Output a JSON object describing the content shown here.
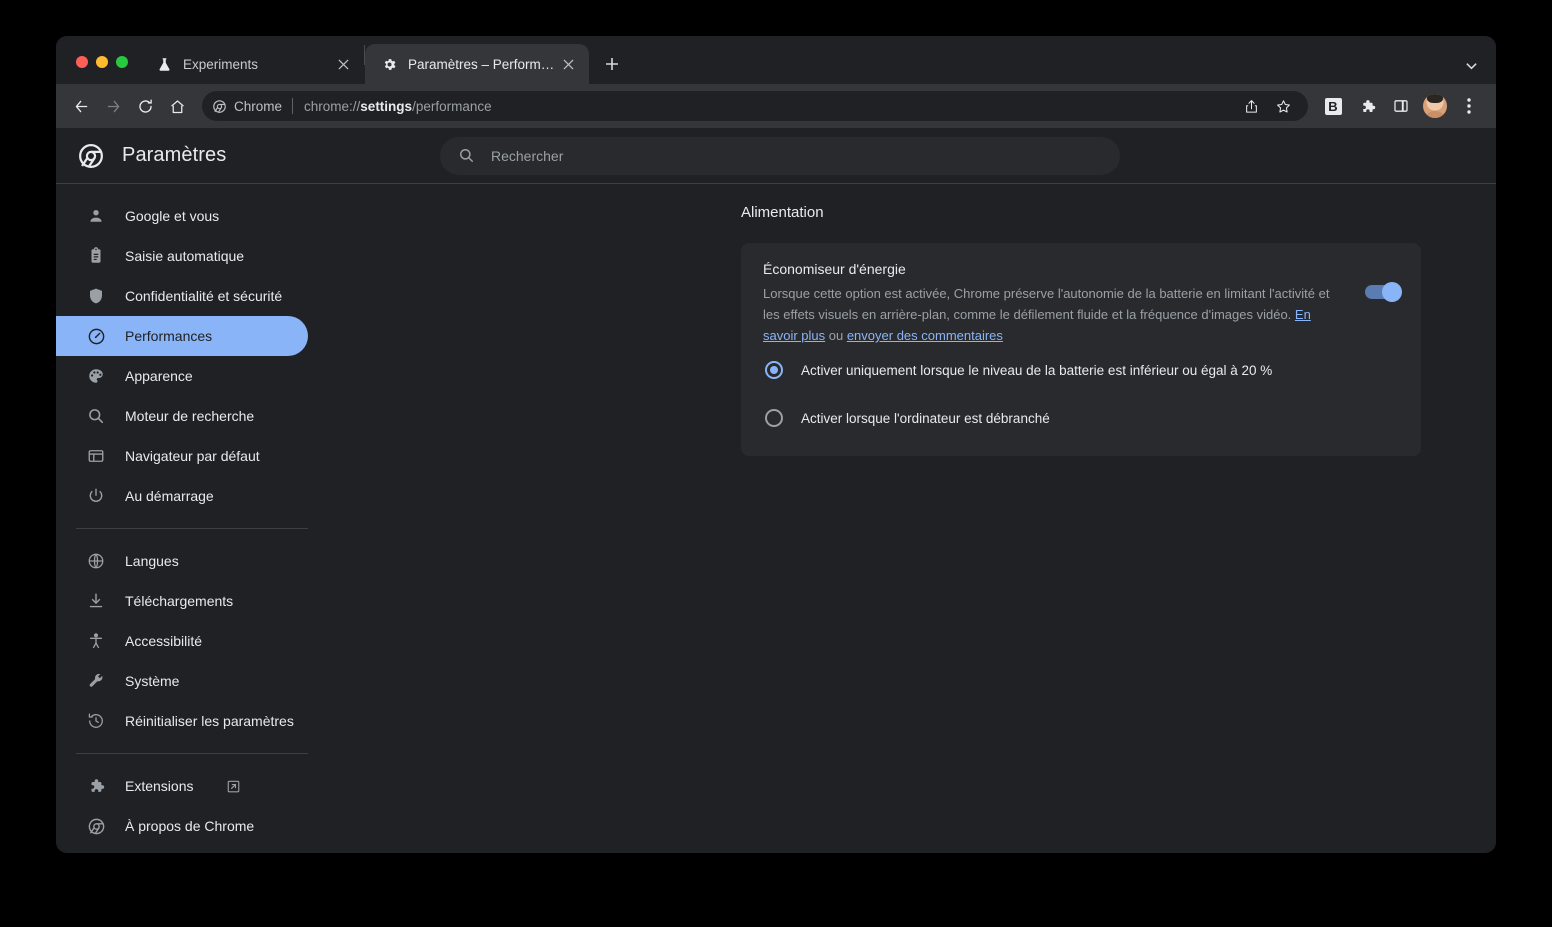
{
  "window": {
    "traffic_lights": [
      "close",
      "minimize",
      "zoom"
    ],
    "tabstrip_chevron": "chevron-down-icon"
  },
  "tabs": [
    {
      "title": "Experiments",
      "favicon": "flask-icon",
      "active": false,
      "close_label": "×"
    },
    {
      "title": "Paramètres – Performances",
      "favicon": "gear-icon",
      "active": true,
      "close_label": "×"
    }
  ],
  "new_tab_label": "+",
  "toolbar": {
    "back_icon": "arrow-left-icon",
    "forward_icon": "arrow-right-icon",
    "reload_icon": "reload-icon",
    "home_icon": "home-icon",
    "omnibox": {
      "chip_label": "Chrome",
      "url_prefix": "chrome://",
      "url_bold": "settings",
      "url_suffix": "/performance",
      "share_icon": "share-icon",
      "bookmark_icon": "star-icon"
    },
    "extension_b_label": "B",
    "extensions_icon": "puzzle-piece-icon",
    "side_panel_icon": "side-panel-icon",
    "profile_icon": "avatar",
    "menu_icon": "three-dot-menu-icon"
  },
  "settings": {
    "brand_title": "Paramètres",
    "brand_icon": "chrome-logo-icon",
    "search": {
      "placeholder": "Rechercher",
      "value": "",
      "icon": "search-icon"
    }
  },
  "sidebar": {
    "groups": [
      {
        "items": [
          {
            "label": "Google et vous",
            "icon": "person-icon",
            "selected": false
          },
          {
            "label": "Saisie automatique",
            "icon": "clipboard-icon",
            "selected": false
          },
          {
            "label": "Confidentialité et sécurité",
            "icon": "shield-icon",
            "selected": false
          },
          {
            "label": "Performances",
            "icon": "speedometer-icon",
            "selected": true
          },
          {
            "label": "Apparence",
            "icon": "palette-icon",
            "selected": false
          },
          {
            "label": "Moteur de recherche",
            "icon": "search-icon",
            "selected": false
          },
          {
            "label": "Navigateur par défaut",
            "icon": "browser-window-icon",
            "selected": false
          },
          {
            "label": "Au démarrage",
            "icon": "power-icon",
            "selected": false
          }
        ]
      },
      {
        "items": [
          {
            "label": "Langues",
            "icon": "globe-icon",
            "selected": false
          },
          {
            "label": "Téléchargements",
            "icon": "download-icon",
            "selected": false
          },
          {
            "label": "Accessibilité",
            "icon": "accessibility-icon",
            "selected": false
          },
          {
            "label": "Système",
            "icon": "wrench-icon",
            "selected": false
          },
          {
            "label": "Réinitialiser les paramètres",
            "icon": "history-restore-icon",
            "selected": false
          }
        ]
      },
      {
        "items": [
          {
            "label": "Extensions",
            "icon": "puzzle-piece-icon",
            "selected": false,
            "external": true
          },
          {
            "label": "À propos de Chrome",
            "icon": "chrome-logo-icon",
            "selected": false
          }
        ]
      }
    ]
  },
  "main": {
    "section_title": "Alimentation",
    "card": {
      "title": "Économiseur d'énergie",
      "desc_part1": "Lorsque cette option est activée, Chrome préserve l'autonomie de la batterie en limitant l'activité et les effets visuels en arrière-plan, comme le défilement fluide et la fréquence d'images vidéo. ",
      "link_learn_more": "En savoir plus",
      "desc_conjunction": " ou ",
      "link_feedback": "envoyer des commentaires",
      "toggle_on": true,
      "radios": [
        {
          "label": "Activer uniquement lorsque le niveau de la batterie est inférieur ou égal à 20 %",
          "checked": true
        },
        {
          "label": "Activer lorsque l'ordinateur est débranché",
          "checked": false
        }
      ]
    }
  },
  "colors": {
    "page_bg": "#202124",
    "card_bg": "#292a2d",
    "toolbar_bg": "#35363a",
    "accent": "#8ab4f8",
    "text_primary": "#e8eaed",
    "text_secondary": "#9aa0a6"
  }
}
